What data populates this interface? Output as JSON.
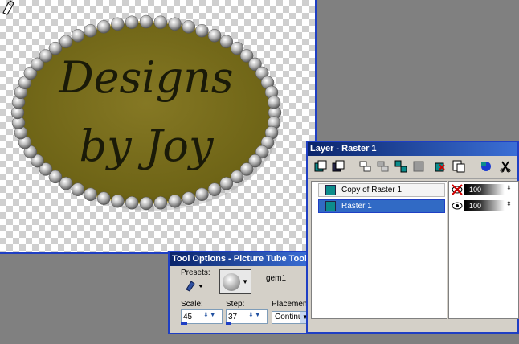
{
  "canvas": {
    "image_text_line1": "Designs",
    "image_text_line2": "by Joy"
  },
  "tool_options": {
    "title": "Tool Options - Picture Tube Tool",
    "presets_label": "Presets:",
    "tube_name": "gem1",
    "scale_label": "Scale:",
    "scale_value": "45",
    "step_label": "Step:",
    "step_value": "37",
    "placement_label": "Placement mode:",
    "placement_value": "Continuous"
  },
  "layers": {
    "title": "Layer - Raster 1",
    "items": [
      {
        "name": "Copy of Raster 1",
        "opacity": "100",
        "visible": false,
        "selected": false
      },
      {
        "name": "Raster 1",
        "opacity": "100",
        "visible": true,
        "selected": true
      }
    ]
  },
  "colors": {
    "window_border": "#1f3fc4",
    "titlebar": "#0a246a",
    "selection": "#316ac5",
    "plaque_fill": "#7a6e1c"
  }
}
